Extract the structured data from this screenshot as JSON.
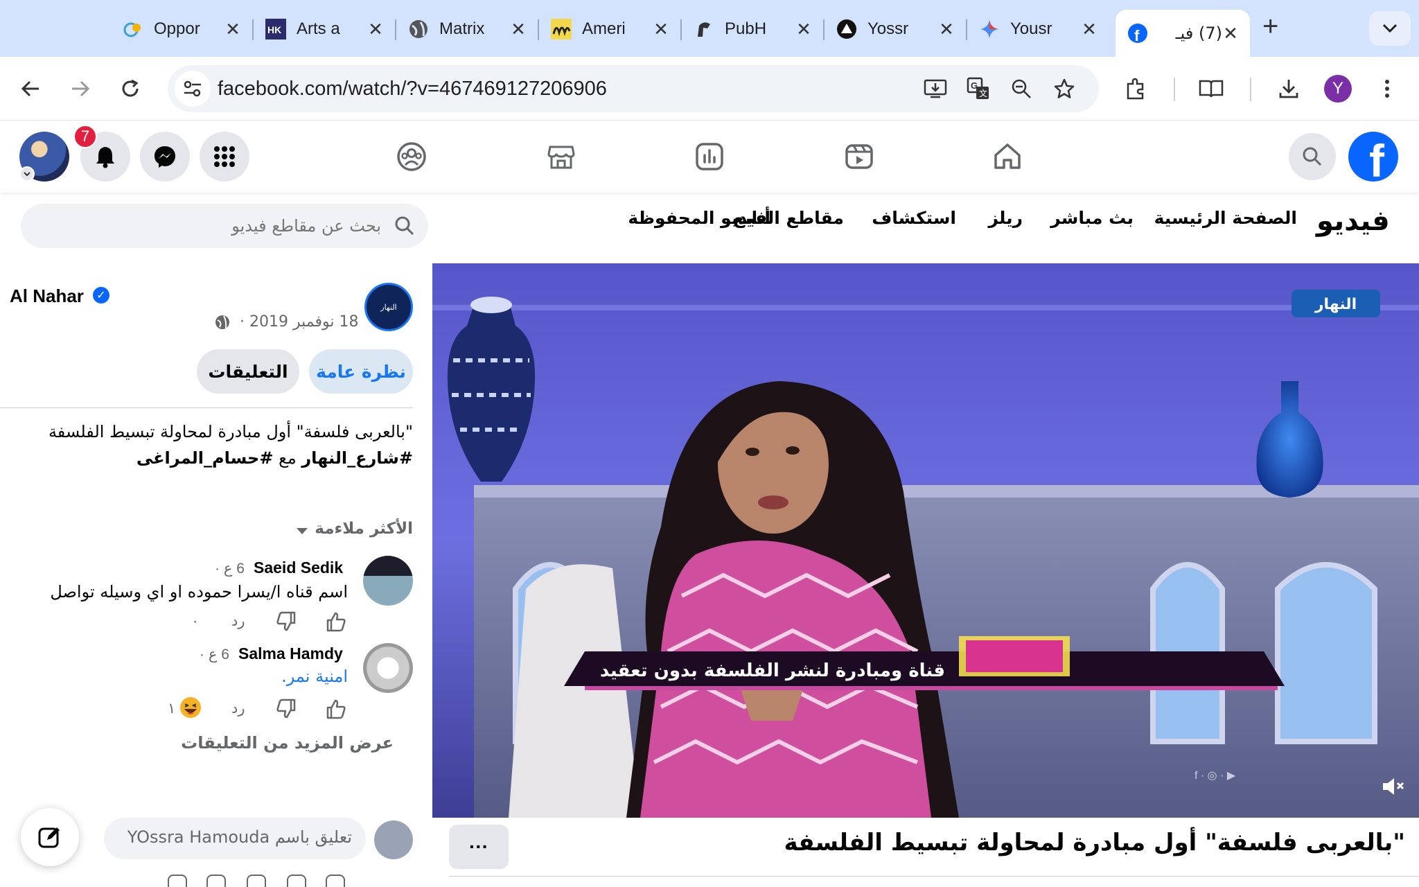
{
  "browser": {
    "tabs": [
      {
        "title": "Oppor",
        "icon": "opportunity-favicon"
      },
      {
        "title": "Arts a",
        "icon": "hk-favicon"
      },
      {
        "title": "Matrix",
        "icon": "globe-icon"
      },
      {
        "title": "Ameri",
        "icon": "ameri-favicon"
      },
      {
        "title": "PubH",
        "icon": "spartan-favicon"
      },
      {
        "title": "Yossr",
        "icon": "triangle-favicon"
      },
      {
        "title": "Yousr",
        "icon": "gemini-favicon"
      },
      {
        "title": "(7) فيـ",
        "icon": "facebook-favicon",
        "active": true
      }
    ],
    "url": "facebook.com/watch/?v=467469127206906",
    "profile_initial": "Y"
  },
  "facebook": {
    "notification_count": "7",
    "logo_letter": "f"
  },
  "video_nav": {
    "title": "فيديو",
    "items": [
      "الصفحة الرئيسية",
      "بث مباشر",
      "ريلز",
      "استكشاف",
      "مقاطع الفيديو المحفوظة",
      "أتابع"
    ],
    "search_placeholder": "بحث عن مقاطع فيديو"
  },
  "post": {
    "page_name": "Al Nahar",
    "date": "18 نوفمبر 2019 ·",
    "tab_overview": "نظرة عامة",
    "tab_comments": "التعليقات",
    "description_line1": "\"بالعربى فلسفة\" أول مبادرة لمحاولة تبسيط الفلسفة",
    "description_tag1": "#شارع_النهار",
    "description_mid": " مع ",
    "description_tag2": "#حسام_المراغى",
    "sort_label": "الأكثر ملاءمة",
    "video_title": "\"بالعربى فلسفة\" أول مبادرة لمحاولة تبسيط الفلسفة",
    "more_label": "···",
    "tv_caption": "قناة ومبادرة لنشر الفلسفة بدون تعقيد",
    "tv_logo": "النهار"
  },
  "comments": [
    {
      "name": "Saeid Sedik",
      "time": "6 ع ·",
      "text": "اسم قناه ا/يسرا حموده او اي وسيله تواصل",
      "reply": "رد",
      "reaction_count": "٠"
    },
    {
      "name": "Salma Hamdy",
      "time": "6 ع ·",
      "text": "امنية نمر.",
      "reply": "رد",
      "reaction_count": "١"
    }
  ],
  "more_comments": "عرض المزيد من التعليقات",
  "composer_placeholder": "تعليق باسم YOssra Hamouda",
  "colors": {
    "facebook_blue": "#0866ff",
    "tab_strip": "#d3e3fd",
    "badge_red": "#e41e3f"
  }
}
